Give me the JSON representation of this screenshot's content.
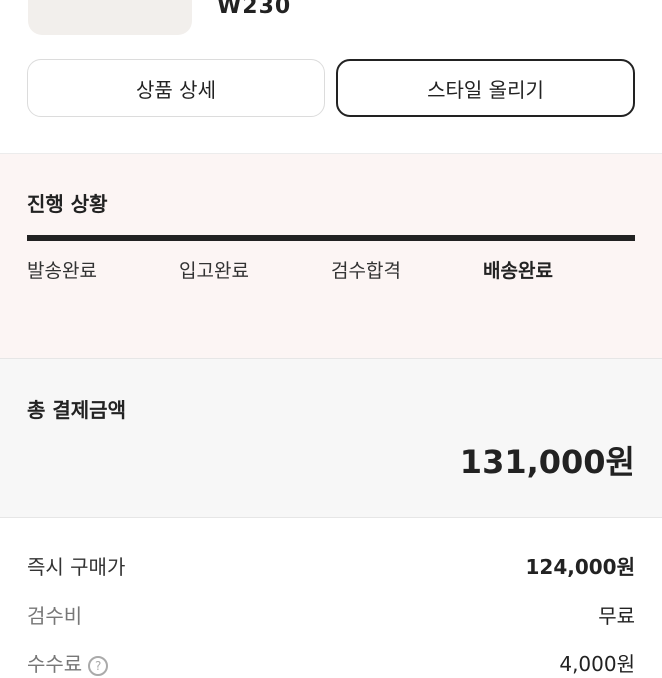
{
  "product": {
    "size": "W230"
  },
  "actions": {
    "detail_label": "상품 상세",
    "style_label": "스타일 올리기"
  },
  "progress": {
    "title": "진행 상황",
    "steps": [
      "발송완료",
      "입고완료",
      "검수합격",
      "배송완료"
    ],
    "active_step": "배송완료"
  },
  "payment": {
    "total_title": "총 결제금액",
    "total_amount": "131,000원",
    "rows": [
      {
        "label": "즉시 구매가",
        "value": "124,000원"
      },
      {
        "label": "검수비",
        "value": "무료"
      },
      {
        "label": "수수료",
        "value": "4,000원"
      }
    ]
  },
  "colors": {
    "progress_bg": "#fcf5f4",
    "total_bg": "#f7f7f7",
    "accent": "#222222"
  }
}
